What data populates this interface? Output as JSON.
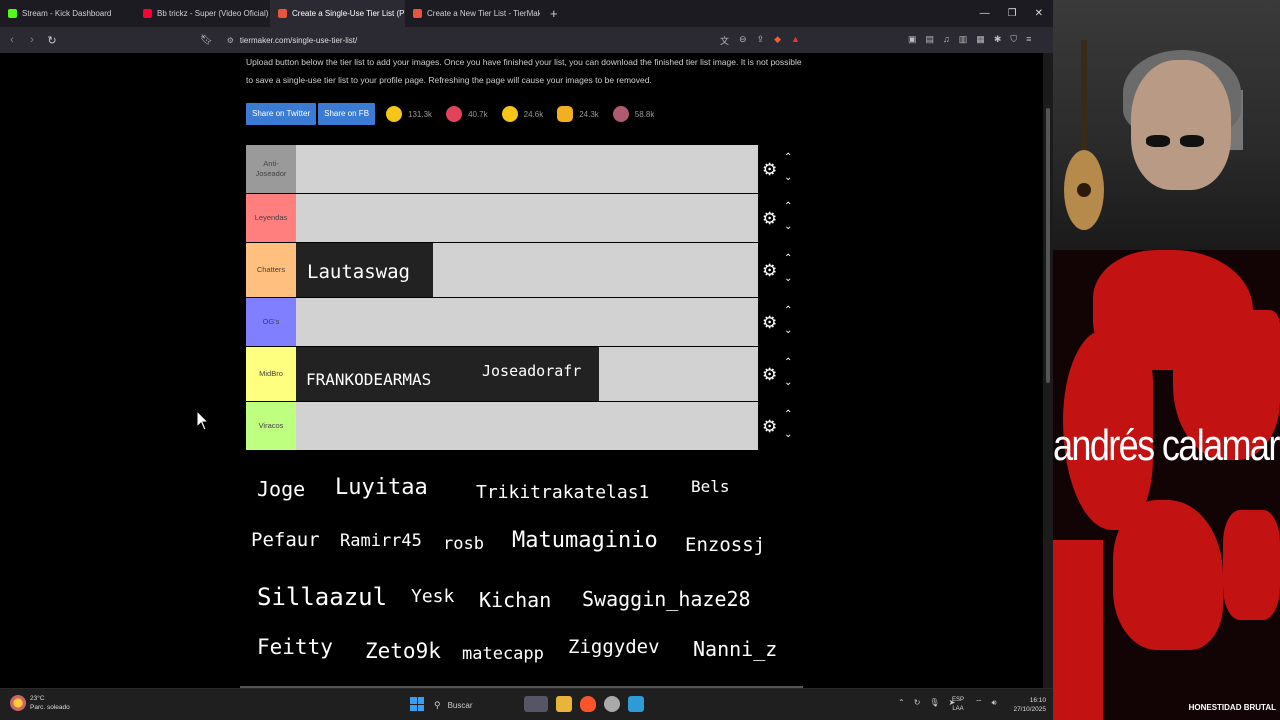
{
  "browser": {
    "tabs": [
      {
        "label": "Stream - Kick Dashboard",
        "color": "#53fc18",
        "active": false
      },
      {
        "label": "Bb trickz - Super (Video Oficial)",
        "color": "#ff0033",
        "active": false
      },
      {
        "label": "Create a Single-Use Tier List (Pri...",
        "color": "#e8553a",
        "active": true
      },
      {
        "label": "Create a New Tier List - TierMaker",
        "color": "#e8553a",
        "active": false
      }
    ],
    "new_tab": "+",
    "url": "tiermaker.com/single-use-tier-list/"
  },
  "page": {
    "intro_line1": "Upload button below the tier list to add your images. Once you have finished your list, you can download the finished tier list image. It is not possible",
    "intro_line2": "to save a single-use tier list to your profile page. Refreshing the page will cause your images to be removed.",
    "share_twitter": "Share on Twitter",
    "share_fb": "Share on FB",
    "reactions": [
      {
        "icon": "grinning-face-icon",
        "count": "131.3k",
        "color": "#f5c518"
      },
      {
        "icon": "heart-eyes-icon",
        "count": "40.7k",
        "color": "#e0435a"
      },
      {
        "icon": "laughing-face-icon",
        "count": "24.6k",
        "color": "#f5c518"
      },
      {
        "icon": "clapping-hands-icon",
        "count": "24.3k",
        "color": "#f0b020"
      },
      {
        "icon": "poop-icon",
        "count": "58.8k",
        "color": "#b05a70"
      }
    ]
  },
  "tiers": [
    {
      "label": "Anti-Joseador",
      "color": "#9a9a9a",
      "items": []
    },
    {
      "label": "Leyendas",
      "color": "#ff7f7f",
      "items": []
    },
    {
      "label": "Chatters",
      "color": "#ffbf7f",
      "items": [
        "Lautaswag"
      ]
    },
    {
      "label": "OG's",
      "color": "#7f7fff",
      "items": []
    },
    {
      "label": "MidBro",
      "color": "#ffff7f",
      "items": [
        "FRANKODEARMAS",
        "Joseadorafr"
      ]
    },
    {
      "label": "Viracos",
      "color": "#bfff7f",
      "items": []
    }
  ],
  "pool": [
    "Joge",
    "Luyitaa",
    "Trikitrakatelas1",
    "Bels",
    "Pefaur",
    "Ramirr45",
    "rosb",
    "Matumaginio",
    "Enzossj",
    "Sillaazul",
    "Yesk",
    "Kichan",
    "Swaggin_haze28",
    "Feitty",
    "Zeto9k",
    "matecapp",
    "Ziggydev",
    "Nanni_z"
  ],
  "webcam": {
    "overlay_text": "andrés calamaro",
    "caption": "HONESTIDAD BRUTAL"
  },
  "taskbar": {
    "temperature": "23°C",
    "weather": "Parc. soleado",
    "search": "Buscar",
    "lang_top": "ESP",
    "lang_bottom": "LAA",
    "time": "16:10",
    "date": "27/10/2025"
  }
}
